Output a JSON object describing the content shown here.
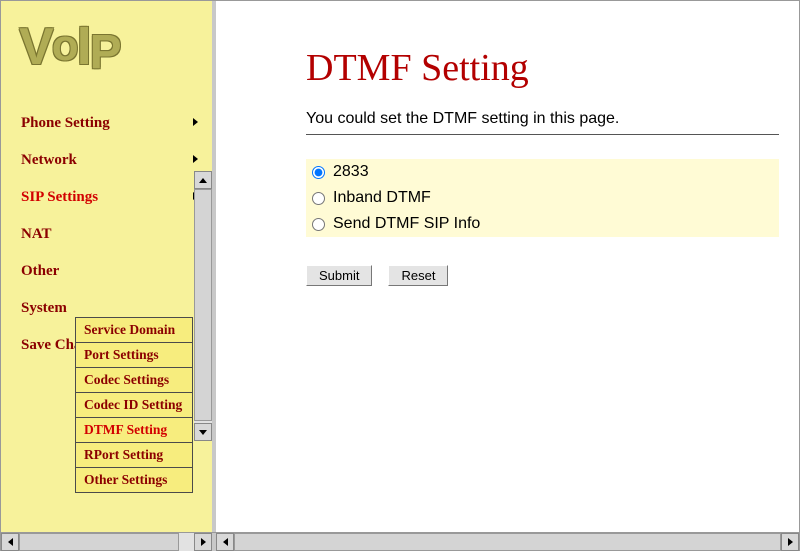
{
  "logo": {
    "text": "VoIP"
  },
  "sidebar": {
    "items": [
      {
        "label": "Phone Setting",
        "has_arrow": true
      },
      {
        "label": "Network",
        "has_arrow": true
      },
      {
        "label": "SIP Settings",
        "has_arrow": true,
        "active": true
      },
      {
        "label": "NAT",
        "has_arrow": false
      },
      {
        "label": "Other",
        "has_arrow": false
      },
      {
        "label": "System",
        "has_arrow": false
      },
      {
        "label": "Save Change",
        "has_arrow": false
      }
    ],
    "submenu": [
      {
        "label": "Service Domain"
      },
      {
        "label": "Port Settings"
      },
      {
        "label": "Codec Settings"
      },
      {
        "label": "Codec ID Setting"
      },
      {
        "label": "DTMF Setting",
        "active": true
      },
      {
        "label": "RPort Setting"
      },
      {
        "label": "Other Settings"
      }
    ]
  },
  "page": {
    "title": "DTMF Setting",
    "description": "You could set the DTMF setting in this page.",
    "options": [
      {
        "label": "2833",
        "checked": true
      },
      {
        "label": "Inband DTMF",
        "checked": false
      },
      {
        "label": "Send DTMF SIP Info",
        "checked": false
      }
    ],
    "buttons": {
      "submit": "Submit",
      "reset": "Reset"
    }
  }
}
